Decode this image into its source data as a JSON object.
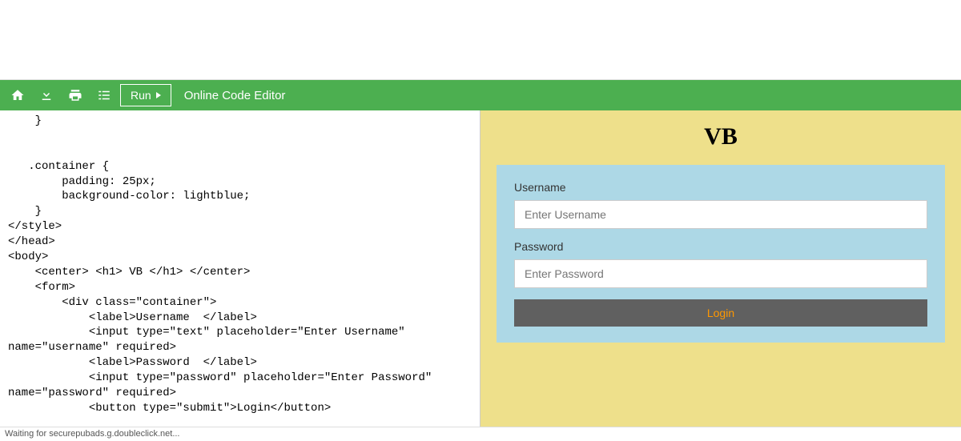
{
  "toolbar": {
    "run_label": "Run",
    "title": "Online Code Editor"
  },
  "code": {
    "l1": "    }",
    "l2": "",
    "l3": "",
    "l4": "   .container {",
    "l5": "        padding: 25px;",
    "l6": "        background-color: lightblue;",
    "l7": "    }",
    "l8": "</style>",
    "l9": "</head>",
    "l10": "<body>",
    "l11": "    <center> <h1> VB </h1> </center>",
    "l12": "    <form>",
    "l13": "        <div class=\"container\">",
    "l14": "            <label>Username  </label>",
    "l15": "            <input type=\"text\" placeholder=\"Enter Username\"",
    "l16": "name=\"username\" required>",
    "l17": "            <label>Password  </label>",
    "l18": "            <input type=\"password\" placeholder=\"Enter Password\"",
    "l19": "name=\"password\" required>",
    "l20": "            <button type=\"submit\">Login</button>"
  },
  "preview": {
    "heading": "VB",
    "username_label": "Username",
    "username_placeholder": "Enter Username",
    "password_label": "Password",
    "password_placeholder": "Enter Password",
    "login_label": "Login"
  },
  "status": "Waiting for securepubads.g.doubleclick.net..."
}
